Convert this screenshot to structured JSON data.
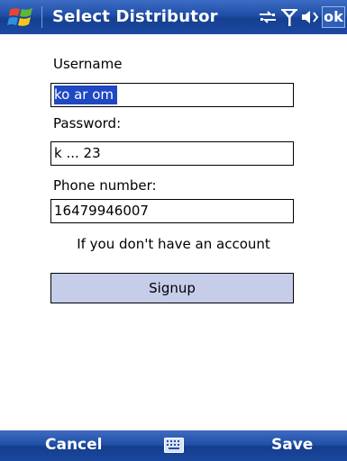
{
  "title_bar": {
    "title": "Select Distributor",
    "ok_label": "ok",
    "icons": [
      "windows-start-icon",
      "connectivity-icon",
      "signal-strength-icon",
      "speaker-icon"
    ]
  },
  "form": {
    "username_label": "Username",
    "username_value": "ko    ar           om",
    "password_label": "Password:",
    "password_value": "k      ...  23",
    "phone_label": "Phone number:",
    "phone_value": "16479946007",
    "info_text": "If you don't have an account",
    "signup_label": "Signup"
  },
  "menu_bar": {
    "left_softkey": "Cancel",
    "right_softkey": "Save",
    "center_icon": "keyboard-icon"
  },
  "colors": {
    "title_bar": "#1f4ea6",
    "selection": "#1f48c2",
    "signup_button": "#c5cde9"
  }
}
